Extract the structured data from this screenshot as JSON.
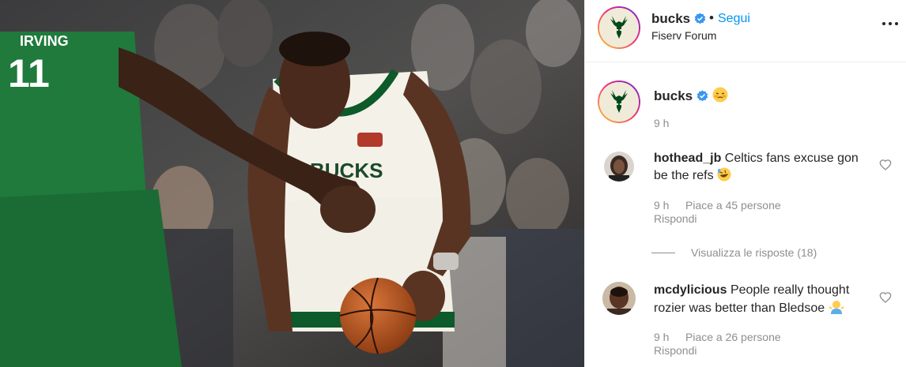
{
  "colors": {
    "accent": "#0095f6",
    "verified": "#3897f0",
    "muted": "#8e8e8e",
    "celtics_green": "#1d7a3a",
    "bucks_green": "#00471b"
  },
  "post": {
    "image_alt_icon": "basketball-photo",
    "jersey_text_left": "IRVING",
    "jersey_number_left": "11",
    "jersey_text_right": "BUCKS"
  },
  "header": {
    "username": "bucks",
    "separator": "•",
    "follow_label": "Segui",
    "location": "Fiserv Forum",
    "more_icon": "more-horizontal-icon"
  },
  "caption": {
    "username": "bucks",
    "emoji": "blushing-face-emoji",
    "time": "9 h"
  },
  "comments": [
    {
      "username": "hothead_jb",
      "text": "Celtics fans excuse gon be the refs",
      "emoji": "rolling-laughing-emoji",
      "time": "9 h",
      "likes": "Piace a 45 persone",
      "reply": "Rispondi"
    },
    {
      "username": "mcdylicious",
      "text": "People really thought rozier was better than Bledsoe",
      "emoji": "person-shrugging-emoji",
      "time": "9 h",
      "likes": "Piace a 26 persone",
      "reply": "Rispondi"
    }
  ],
  "view_replies": "Visualizza le risposte (18)"
}
